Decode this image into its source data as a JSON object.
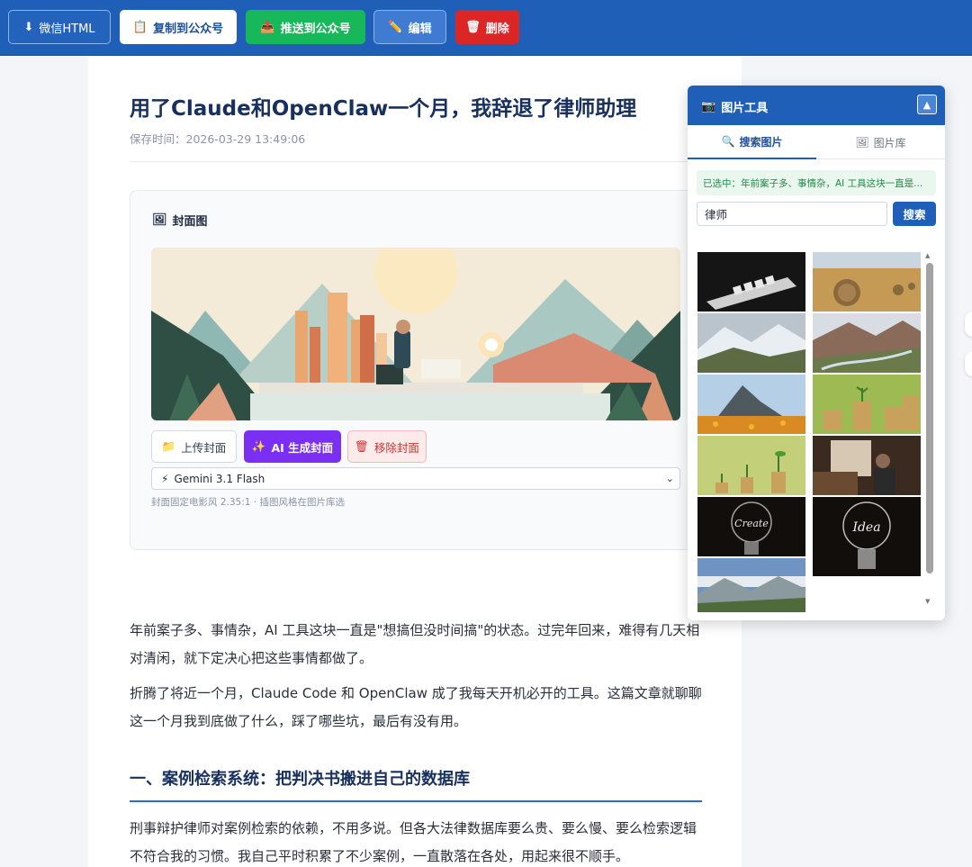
{
  "toolbar": {
    "wechat_html": "微信HTML",
    "copy_to_mp": "复制到公众号",
    "push_to_mp": "推送到公众号",
    "edit": "编辑",
    "delete": "删除"
  },
  "article": {
    "title": "用了Claude和OpenClaw一个月，我辞退了律师助理",
    "save_time": "保存时间：2026-03-29 13:49:06",
    "cover": {
      "label": "封面图",
      "upload_button": "上传封面",
      "ai_button": "AI 生成封面",
      "remove_button": "移除封面",
      "model_selected": "Gemini 3.1 Flash",
      "hint": "封面固定电影风 2.35:1 · 插图风格在图片库选"
    },
    "paragraphs": [
      "年前案子多、事情杂，AI 工具这块一直是\"想搞但没时间搞\"的状态。过完年回来，难得有几天相对清闲，就下定决心把这些事情都做了。",
      "折腾了将近一个月，Claude Code 和 OpenClaw 成了我每天开机必开的工具。这篇文章就聊聊这一个月我到底做了什么，踩了哪些坑，最后有没有用。"
    ],
    "section_heading": "一、案例检索系统：把判决书搬进自己的数据库",
    "section_paragraph": "刑事辩护律师对案例检索的依赖，不用多说。但各大法律数据库要么贵、要么慢、要么检索逻辑不符合我的习惯。我自己平时积累了不少案例，一直散落在各处，用起来很不顺手。"
  },
  "image_panel": {
    "title": "图片工具",
    "collapse_icon": "▲",
    "tabs": {
      "search": "搜索图片",
      "library": "图片库"
    },
    "selected_note": "已选中：年前案子多、事情杂，AI 工具这块一直是...",
    "search_value": "律师",
    "search_button": "搜索",
    "thumbnails": [
      "lawyer-scrabble-tiles",
      "hay-bales-field",
      "snowy-mountains",
      "river-valley",
      "rocky-peak-flowers",
      "coin-stacks-sprouts",
      "seedlings-coins",
      "woman-office-window",
      "create-lightbulb",
      "idea-lightbulb",
      "alpine-landscape"
    ]
  },
  "colors": {
    "brand_blue": "#1f5fb8",
    "green": "#16b85a",
    "red": "#dc2626",
    "purple": "#7b2ff2"
  }
}
